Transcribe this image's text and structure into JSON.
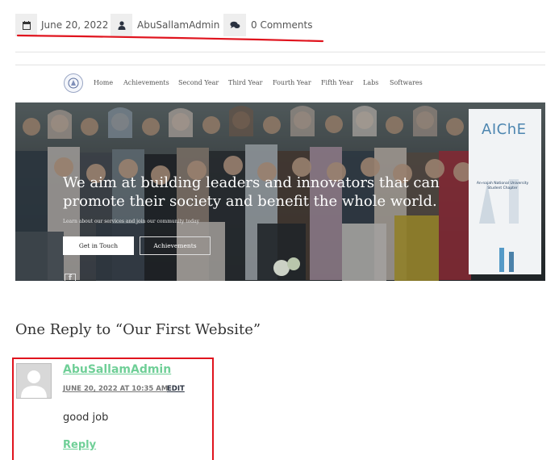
{
  "post_meta": {
    "date": "June 20, 2022",
    "author": "AbuSallamAdmin",
    "comments": "0 Comments",
    "icons": [
      "calendar-icon",
      "user-icon",
      "comments-icon"
    ]
  },
  "site_preview": {
    "nav": [
      "Home",
      "Achievements",
      "Second Year",
      "Third Year",
      "Fourth Year",
      "Fifth Year",
      "Labs",
      "Softwares"
    ],
    "hero": {
      "headline_line1": "We aim at building leaders and innovators that can",
      "headline_line2": "promote their society and benefit the whole world.",
      "subtext": "Learn about our services and join our community today",
      "primary_button": "Get in Touch",
      "secondary_button": "Achievements",
      "banner_brand": "AIChE",
      "banner_text": "An-najah National University Student Chapter"
    }
  },
  "comments_section": {
    "title": "One Reply to “Our First Website”",
    "comment": {
      "author": "AbuSallamAdmin",
      "date": "JUNE 20, 2022 AT 10:35 AM",
      "edit": "EDIT",
      "body": "good job",
      "reply": "Reply"
    }
  },
  "colors": {
    "annotation_red": "#e0141e",
    "link_green": "#6fcf97",
    "meta_bg": "#eeeeee"
  }
}
